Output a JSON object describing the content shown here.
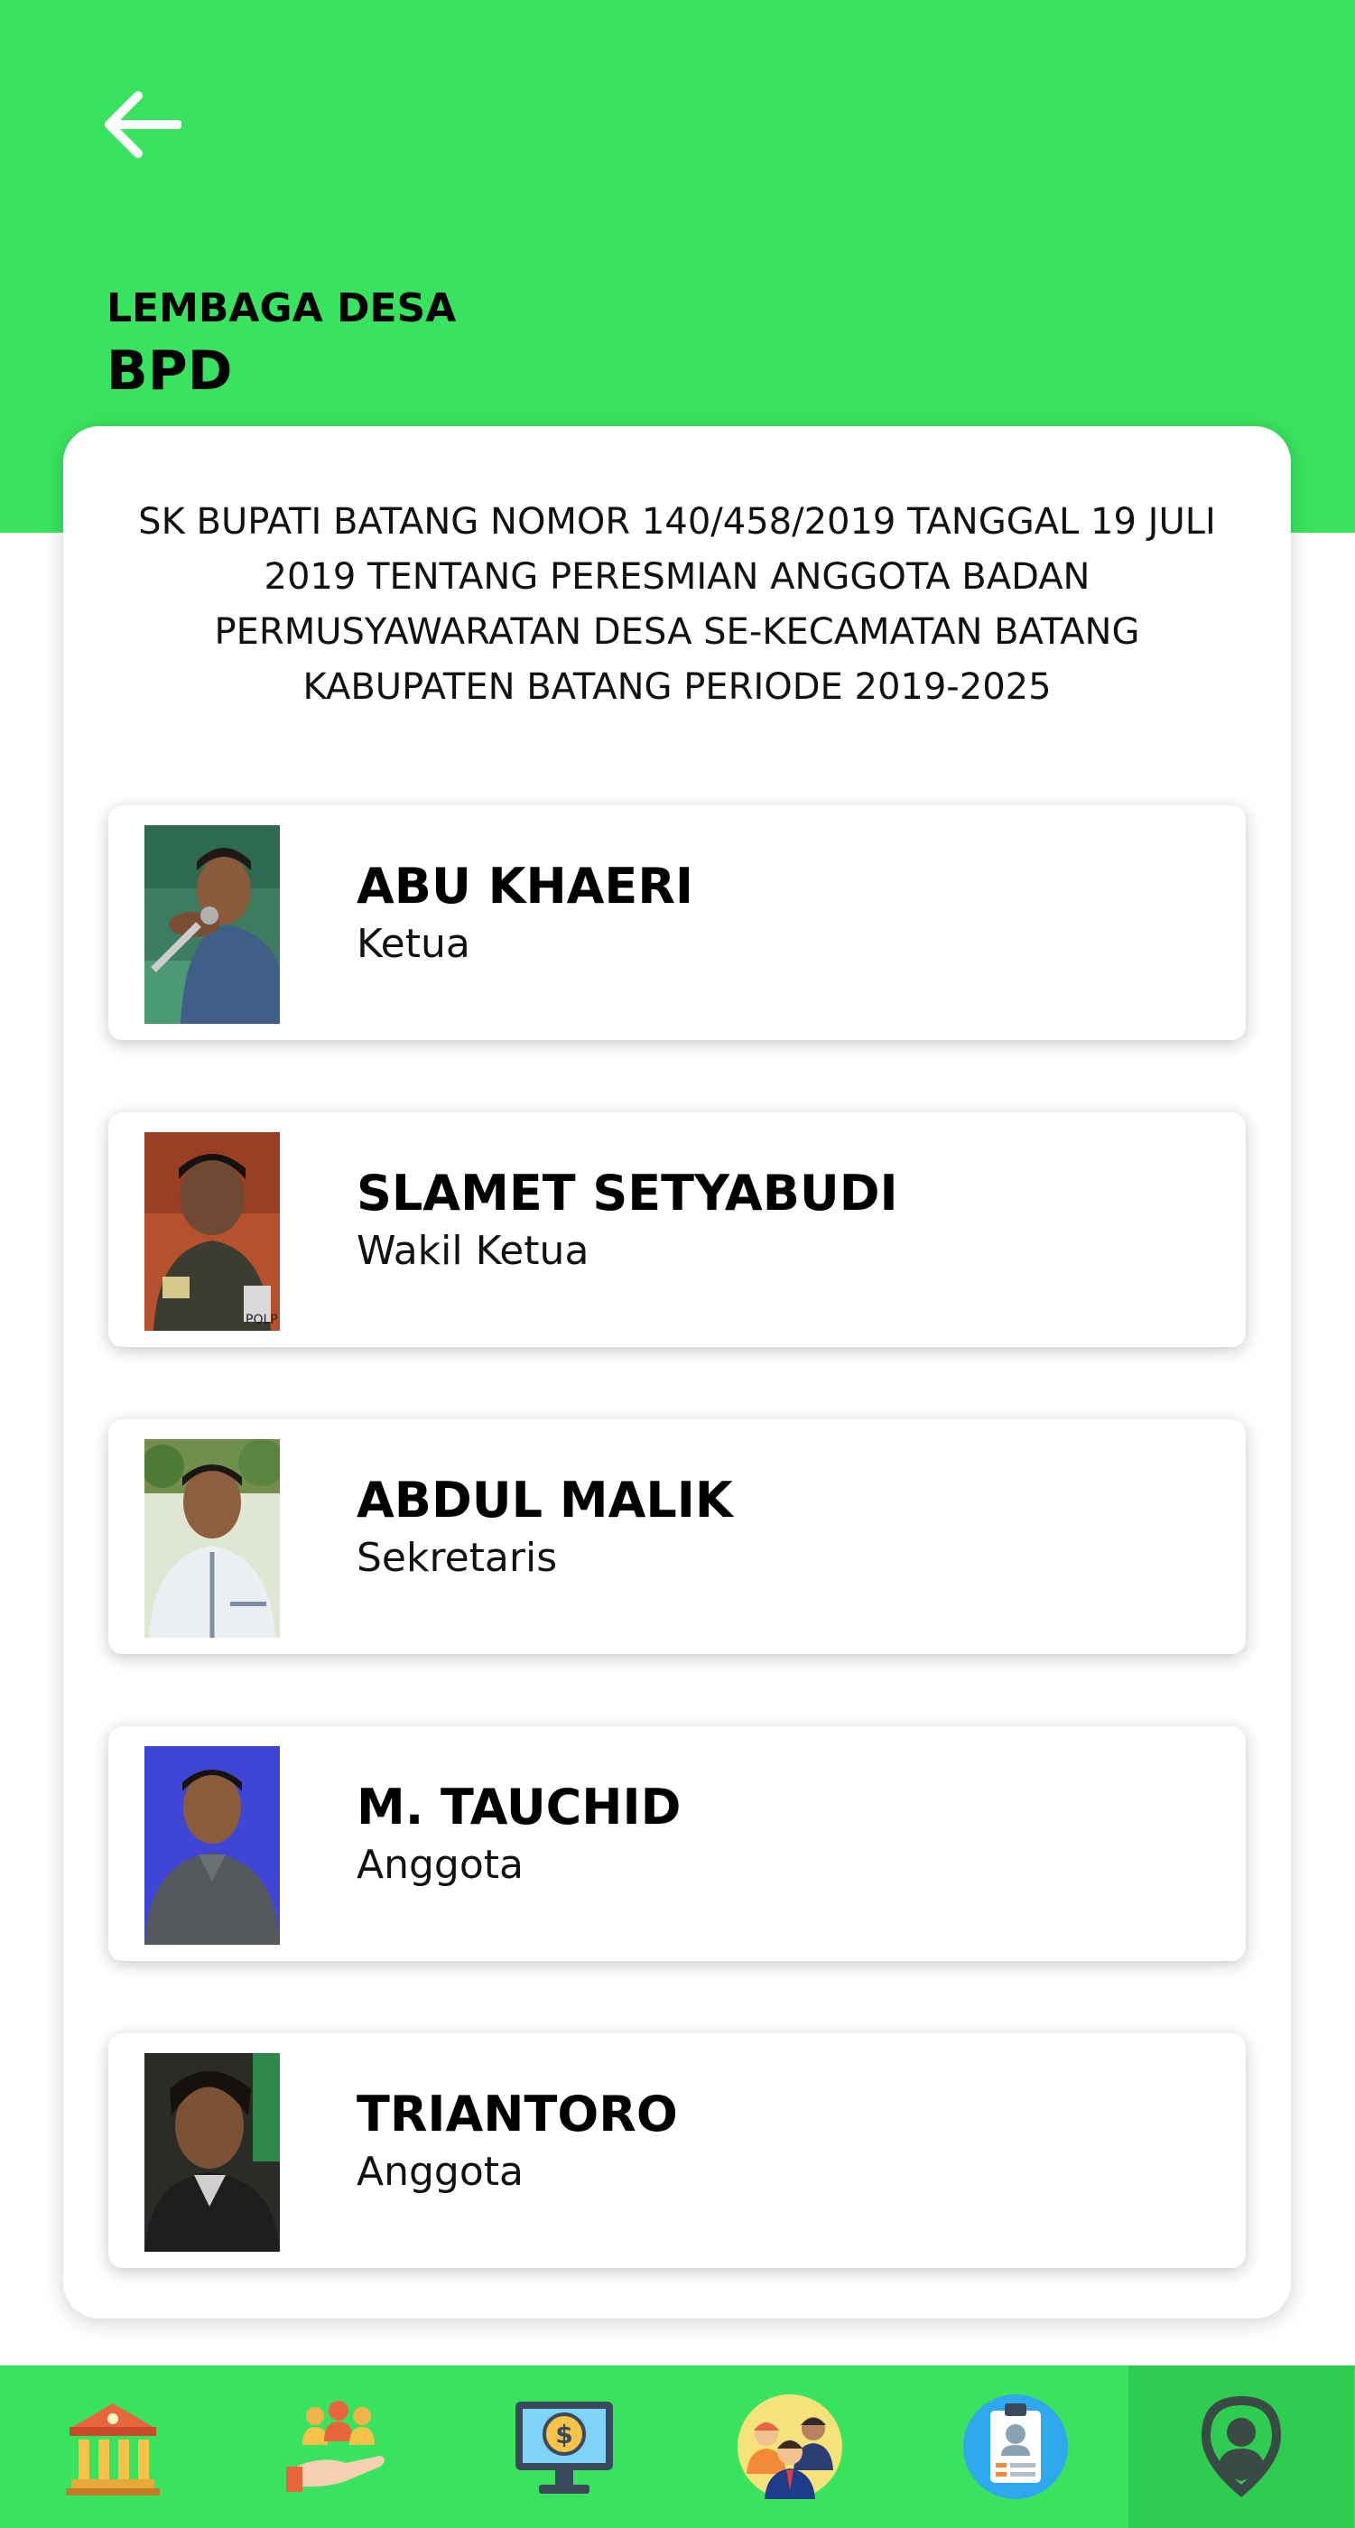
{
  "header": {
    "kicker": "LEMBAGA DESA",
    "title": "BPD",
    "back_icon": "arrow-left-icon"
  },
  "decree_text": "SK BUPATI BATANG NOMOR 140/458/2019 TANGGAL 19 JULI 2019 TENTANG PERESMIAN ANGGOTA BADAN PERMUSYAWARATAN DESA SE-KECAMATAN BATANG KABUPATEN BATANG PERIODE 2019-2025",
  "members": [
    {
      "name": "ABU KHAERI",
      "role": "Ketua"
    },
    {
      "name": "SLAMET SETYABUDI",
      "role": "Wakil Ketua"
    },
    {
      "name": "ABDUL MALIK",
      "role": "Sekretaris"
    },
    {
      "name": "M. TAUCHID",
      "role": "Anggota"
    },
    {
      "name": "TRIANTORO",
      "role": "Anggota"
    }
  ],
  "bottom_nav": [
    {
      "icon": "government-building-icon",
      "active": false
    },
    {
      "icon": "community-hand-icon",
      "active": false
    },
    {
      "icon": "finance-monitor-icon",
      "active": false
    },
    {
      "icon": "people-group-icon",
      "active": false
    },
    {
      "icon": "id-card-clipboard-icon",
      "active": false
    },
    {
      "icon": "location-person-pin-icon",
      "active": true
    }
  ],
  "colors": {
    "primary_green": "#3ae35f",
    "active_nav": "#2ecc51"
  }
}
